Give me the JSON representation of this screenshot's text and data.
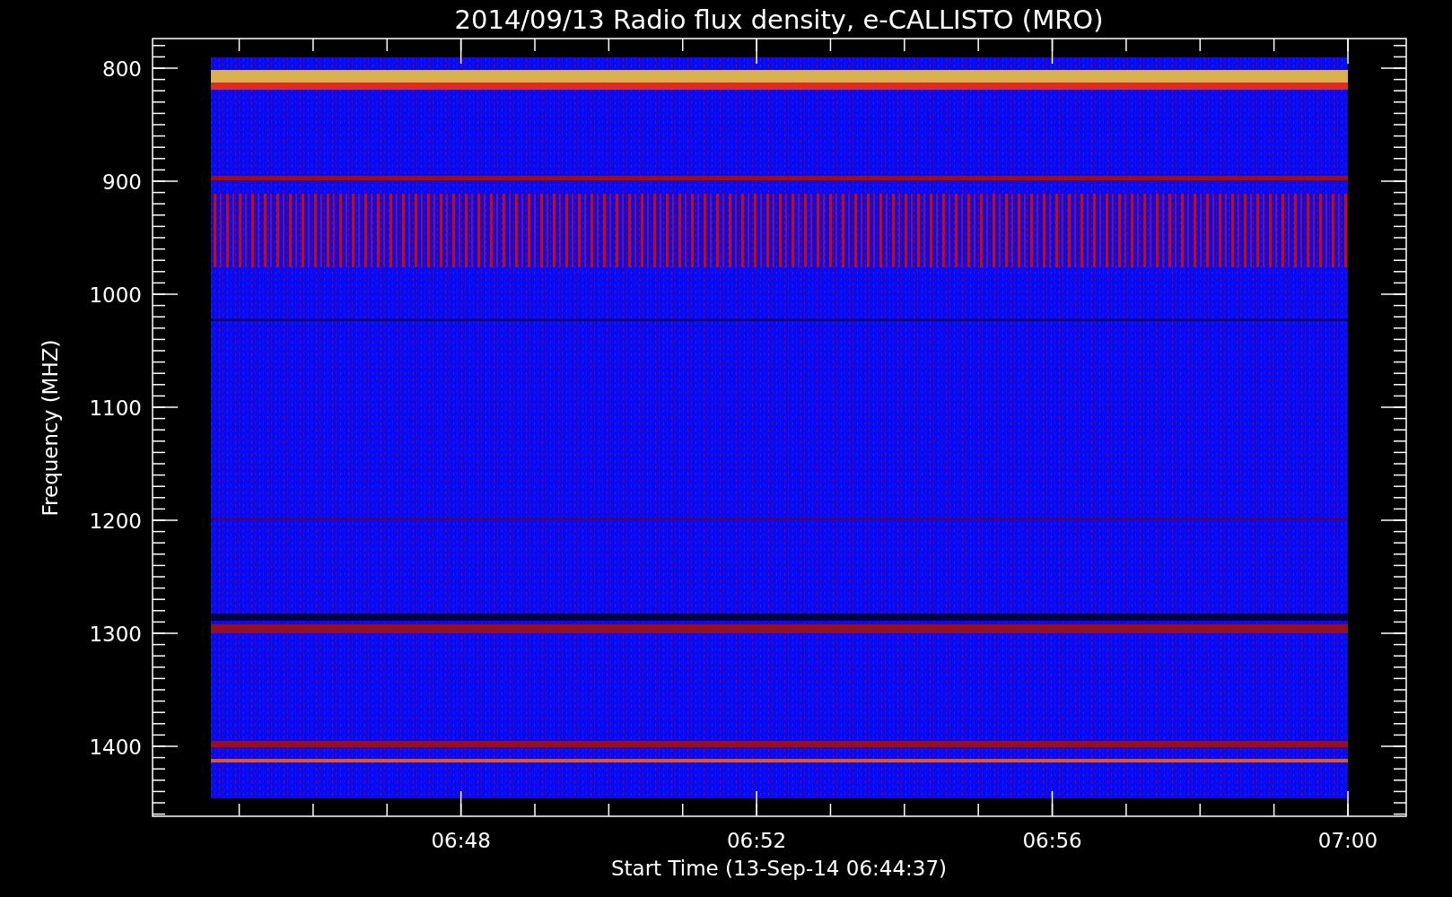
{
  "plot": {
    "title": "2014/09/13  Radio flux density, e-CALLISTO (MRO)",
    "ylabel": "Frequency (MHZ)",
    "xlabel": "Start Time (13-Sep-14 06:44:37)",
    "yticks": [
      "800",
      "900",
      "1000",
      "1100",
      "1200",
      "1300",
      "1400"
    ],
    "xticks": [
      "06:48",
      "06:52",
      "06:56",
      "07:00"
    ]
  }
}
